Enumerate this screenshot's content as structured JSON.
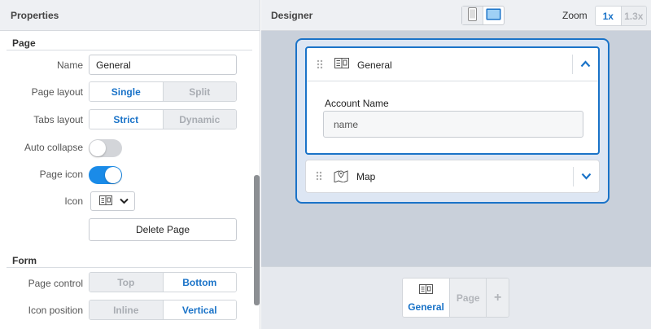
{
  "properties": {
    "title": "Properties",
    "page_section": {
      "title": "Page",
      "name_label": "Name",
      "name_value": "General",
      "page_layout_label": "Page layout",
      "page_layout_options": [
        "Single",
        "Split"
      ],
      "page_layout_selected": "Single",
      "tabs_layout_label": "Tabs layout",
      "tabs_layout_options": [
        "Strict",
        "Dynamic"
      ],
      "tabs_layout_selected": "Strict",
      "auto_collapse_label": "Auto collapse",
      "auto_collapse_on": false,
      "page_icon_label": "Page icon",
      "page_icon_on": true,
      "icon_label": "Icon",
      "icon_value": "book-icon",
      "delete_button": "Delete Page"
    },
    "form_section": {
      "title": "Form",
      "page_control_label": "Page control",
      "page_control_options": [
        "Top",
        "Bottom"
      ],
      "page_control_selected": "Bottom",
      "icon_position_label": "Icon position",
      "icon_position_options": [
        "Inline",
        "Vertical"
      ],
      "icon_position_selected": "Vertical"
    }
  },
  "designer": {
    "title": "Designer",
    "device_options": [
      "phone",
      "tablet"
    ],
    "device_selected": "tablet",
    "zoom_label": "Zoom",
    "zoom_options": [
      "1x",
      "1.3x"
    ],
    "zoom_selected": "1x",
    "cards": [
      {
        "title": "General",
        "icon": "book-icon",
        "expanded": true,
        "field_label": "Account Name",
        "field_placeholder": "name"
      },
      {
        "title": "Map",
        "icon": "map-icon",
        "expanded": false
      }
    ],
    "page_tabs": {
      "active": "General",
      "inactive": "Page",
      "add": "+"
    }
  },
  "colors": {
    "accent": "#1a73c8",
    "toggle_on": "#1a8be8",
    "canvas_bg": "#c9d0da"
  }
}
